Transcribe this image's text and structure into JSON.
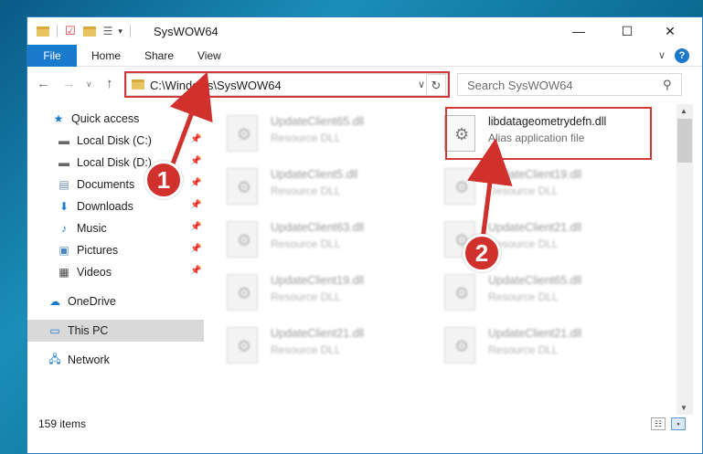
{
  "window": {
    "title": "SysWOW64",
    "controls": {
      "minimize": "—",
      "maximize": "☐",
      "close": "✕"
    }
  },
  "ribbon": {
    "file": "File",
    "tabs": [
      "Home",
      "Share",
      "View"
    ],
    "help": "?"
  },
  "nav": {
    "address": "C:\\Windows\\SysWOW64",
    "search_placeholder": "Search SysWOW64"
  },
  "sidebar": {
    "items": [
      {
        "label": "Quick access",
        "icon": "star-icon"
      },
      {
        "label": "Local Disk (C:)",
        "icon": "drive-icon"
      },
      {
        "label": "Local Disk (D:)",
        "icon": "drive-icon"
      },
      {
        "label": "Documents",
        "icon": "documents-icon"
      },
      {
        "label": "Downloads",
        "icon": "download-icon"
      },
      {
        "label": "Music",
        "icon": "music-icon"
      },
      {
        "label": "Pictures",
        "icon": "pictures-icon"
      },
      {
        "label": "Videos",
        "icon": "videos-icon"
      },
      {
        "label": "OneDrive",
        "icon": "cloud-icon"
      },
      {
        "label": "This PC",
        "icon": "computer-icon"
      },
      {
        "label": "Network",
        "icon": "network-icon"
      }
    ]
  },
  "files": [
    {
      "name": "UpdateClient65.dll",
      "type": "Resource DLL"
    },
    {
      "name": "libdatageometrydefn.dll",
      "type": "Alias application file"
    },
    {
      "name": "UpdateClient5.dll",
      "type": "Resource DLL"
    },
    {
      "name": "UpdateClient19.dll",
      "type": "Resource DLL"
    },
    {
      "name": "UpdateClient63.dll",
      "type": "Resource DLL"
    },
    {
      "name": "UpdateClient21.dll",
      "type": "Resource DLL"
    },
    {
      "name": "UpdateClient19.dll",
      "type": "Resource DLL"
    },
    {
      "name": "UpdateClient65.dll",
      "type": "Resource DLL"
    },
    {
      "name": "UpdateClient21.dll",
      "type": "Resource DLL"
    },
    {
      "name": "UpdateClient21.dll",
      "type": "Resource DLL"
    }
  ],
  "status": {
    "count": "159 items"
  },
  "annotations": {
    "step1": "1",
    "step2": "2",
    "accent": "#d0312d"
  }
}
